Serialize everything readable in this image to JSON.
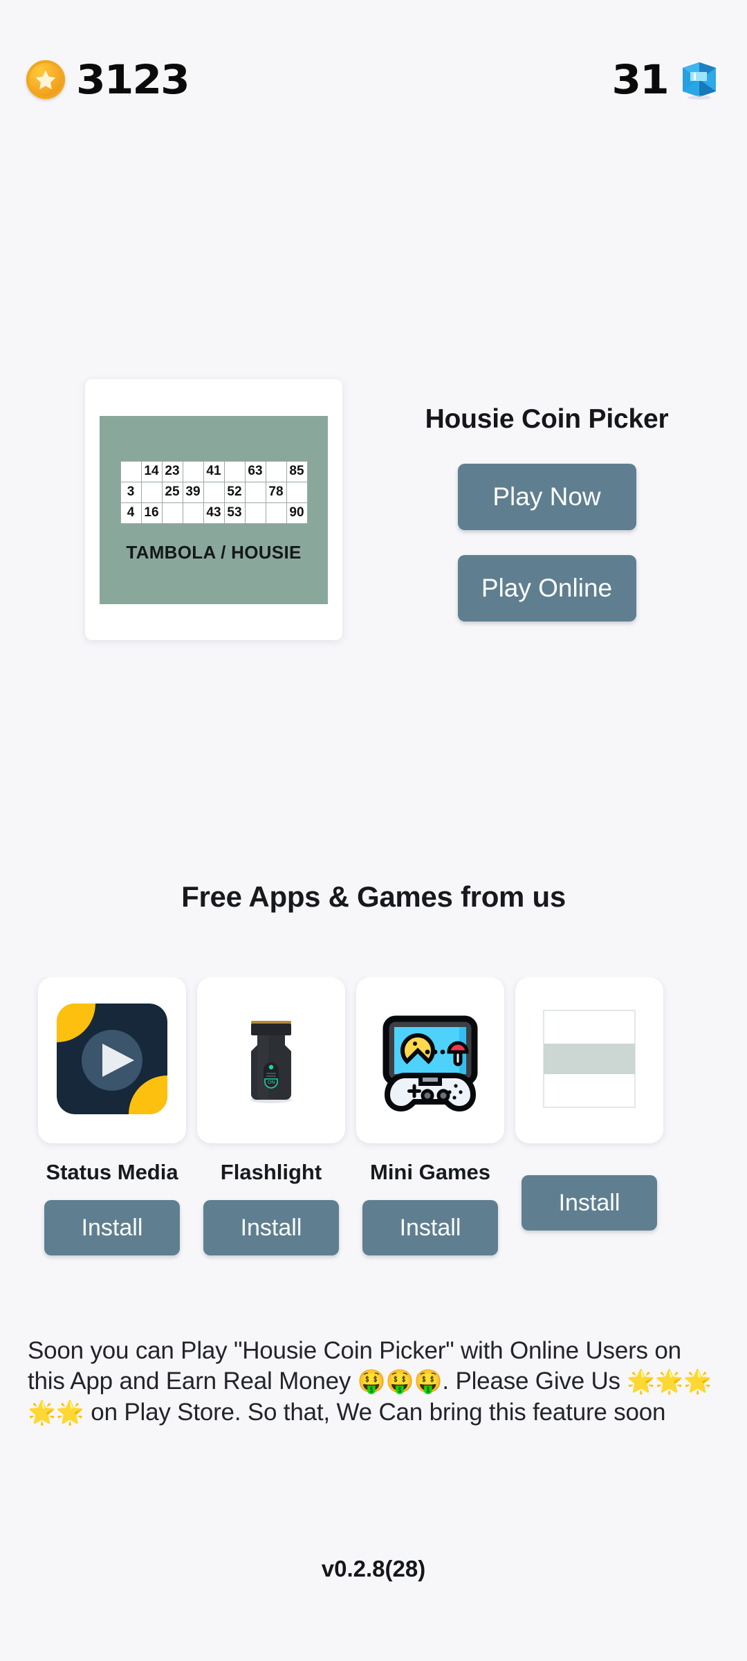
{
  "topbar": {
    "coin_icon": "gold-coin-star-icon",
    "coin_value": "3123",
    "gem_value": "31",
    "gem_icon": "blue-diamond-icon"
  },
  "hero": {
    "title": "Housie Coin Picker",
    "card_caption": "TAMBOLA / HOUSIE",
    "card_bg_color": "#8aa79b",
    "play_now_label": "Play Now",
    "play_online_label": "Play Online",
    "button_color": "#5f7f90",
    "ticket_rows": [
      [
        "",
        "14",
        "23",
        "",
        "41",
        "",
        "63",
        "",
        "85"
      ],
      [
        "3",
        "",
        "25",
        "39",
        "",
        "52",
        "",
        "78",
        ""
      ],
      [
        "4",
        "16",
        "",
        "",
        "43",
        "53",
        "",
        "",
        "90"
      ]
    ]
  },
  "apps_section": {
    "title": "Free Apps & Games from us",
    "items": [
      {
        "name": "Status Media",
        "icon": "status-media-icon",
        "install_label": "Install"
      },
      {
        "name": "Flashlight",
        "icon": "flashlight-icon",
        "install_label": "Install"
      },
      {
        "name": "Mini Games",
        "icon": "mini-games-icon",
        "install_label": "Install"
      },
      {
        "name": "",
        "icon": "partial-app-icon",
        "install_label": "Install"
      }
    ]
  },
  "promo": {
    "line1": "Soon you can Play \"Housie Coin Picker\" with Online",
    "line2_a": "Users on this App and Earn Real Money ",
    "money_emoji": "🤑🤑🤑",
    "line2_b": ".",
    "line3_a": "Please Give Us ",
    "star_emoji": "🌟🌟🌟🌟🌟",
    "line3_b": " on Play Store. So that,",
    "line4": "We Can bring this feature soon"
  },
  "footer": {
    "version": "v0.2.8(28)"
  }
}
